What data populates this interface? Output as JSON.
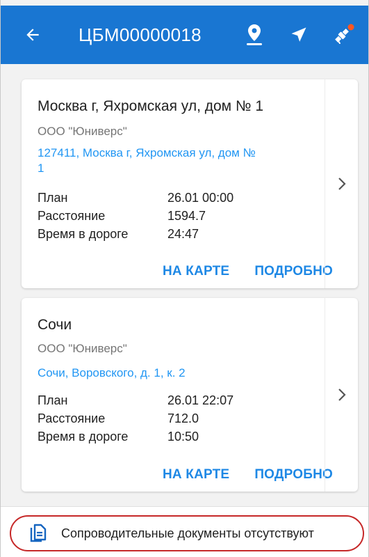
{
  "appbar": {
    "title": "ЦБМ00000018",
    "icons": [
      "back-arrow-icon",
      "map-pin-icon",
      "navigation-arrow-icon",
      "satellite-icon"
    ],
    "accent": "#1976d2",
    "badge_color": "#ff5722"
  },
  "stops": [
    {
      "name": "Москва г, Яхромская ул, дом № 1",
      "org": "ООО \"Юниверс\"",
      "address_line1": "127411, Москва г, Яхромская ул, дом №",
      "address_line2": "1",
      "rows": [
        {
          "label": "План",
          "value": "26.01 00:00"
        },
        {
          "label": "Расстояние",
          "value": "1594.7"
        },
        {
          "label": "Время в дороге",
          "value": "24:47"
        }
      ],
      "map_label": "НА КАРТЕ",
      "details_label": "ПОДРОБНО"
    },
    {
      "name": "Сочи",
      "org": "ООО \"Юниверс\"",
      "address_line1": "Сочи, Воровского, д. 1, к. 2",
      "address_line2": "",
      "rows": [
        {
          "label": "План",
          "value": "26.01 22:07"
        },
        {
          "label": "Расстояние",
          "value": "712.0"
        },
        {
          "label": "Время в дороге",
          "value": "10:50"
        }
      ],
      "map_label": "НА КАРТЕ",
      "details_label": "ПОДРОБНО"
    }
  ],
  "footer": {
    "documents_text": "Сопроводительные документы отсутствуют",
    "icon": "document-copy-icon",
    "highlight_color": "#c62828"
  }
}
